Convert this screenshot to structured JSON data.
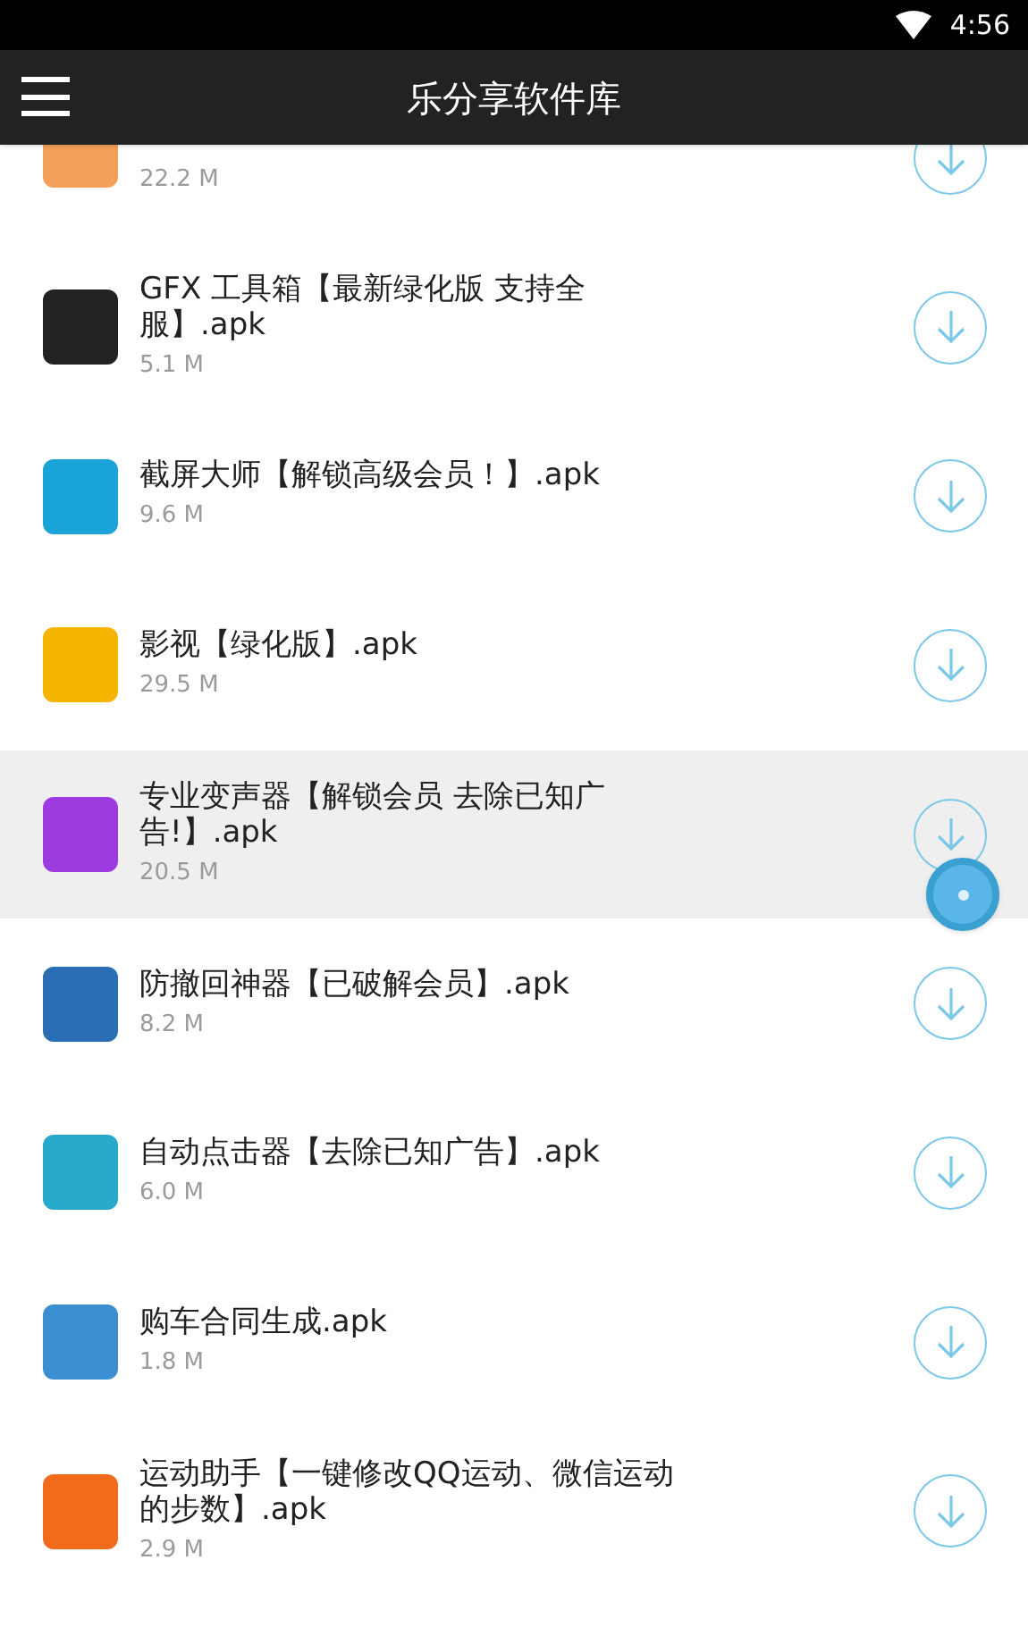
{
  "status_bar": {
    "time": "4:56"
  },
  "app_bar": {
    "title": "乐分享软件库"
  },
  "apps": [
    {
      "size": "22.2 M",
      "color": "#f5a05a",
      "selected": false
    },
    {
      "title": "GFX 工具箱【最新绿化版 支持全服】.apk",
      "size": "5.1 M",
      "color": "#222222",
      "selected": false
    },
    {
      "title": "截屏大师【解锁高级会员！】.apk",
      "size": "9.6 M",
      "color": "#1aa3d6",
      "selected": false
    },
    {
      "title": "影视【绿化版】.apk",
      "size": "29.5 M",
      "color": "#f5b400",
      "selected": false
    },
    {
      "title": "专业变声器【解锁会员 去除已知广告!】.apk",
      "size": "20.5 M",
      "color": "#9b3be0",
      "selected": true
    },
    {
      "title": "防撤回神器【已破解会员】.apk",
      "size": "8.2 M",
      "color": "#2a6fb5",
      "selected": false
    },
    {
      "title": "自动点击器【去除已知广告】.apk",
      "size": "6.0 M",
      "color": "#27a9c9",
      "selected": false
    },
    {
      "title": "购车合同生成.apk",
      "size": "1.8 M",
      "color": "#3b8fd0",
      "selected": false
    },
    {
      "title": "运动助手【一键修改QQ运动、微信运动的步数】.apk",
      "size": "2.9 M",
      "color": "#f26b1d",
      "selected": false
    }
  ]
}
